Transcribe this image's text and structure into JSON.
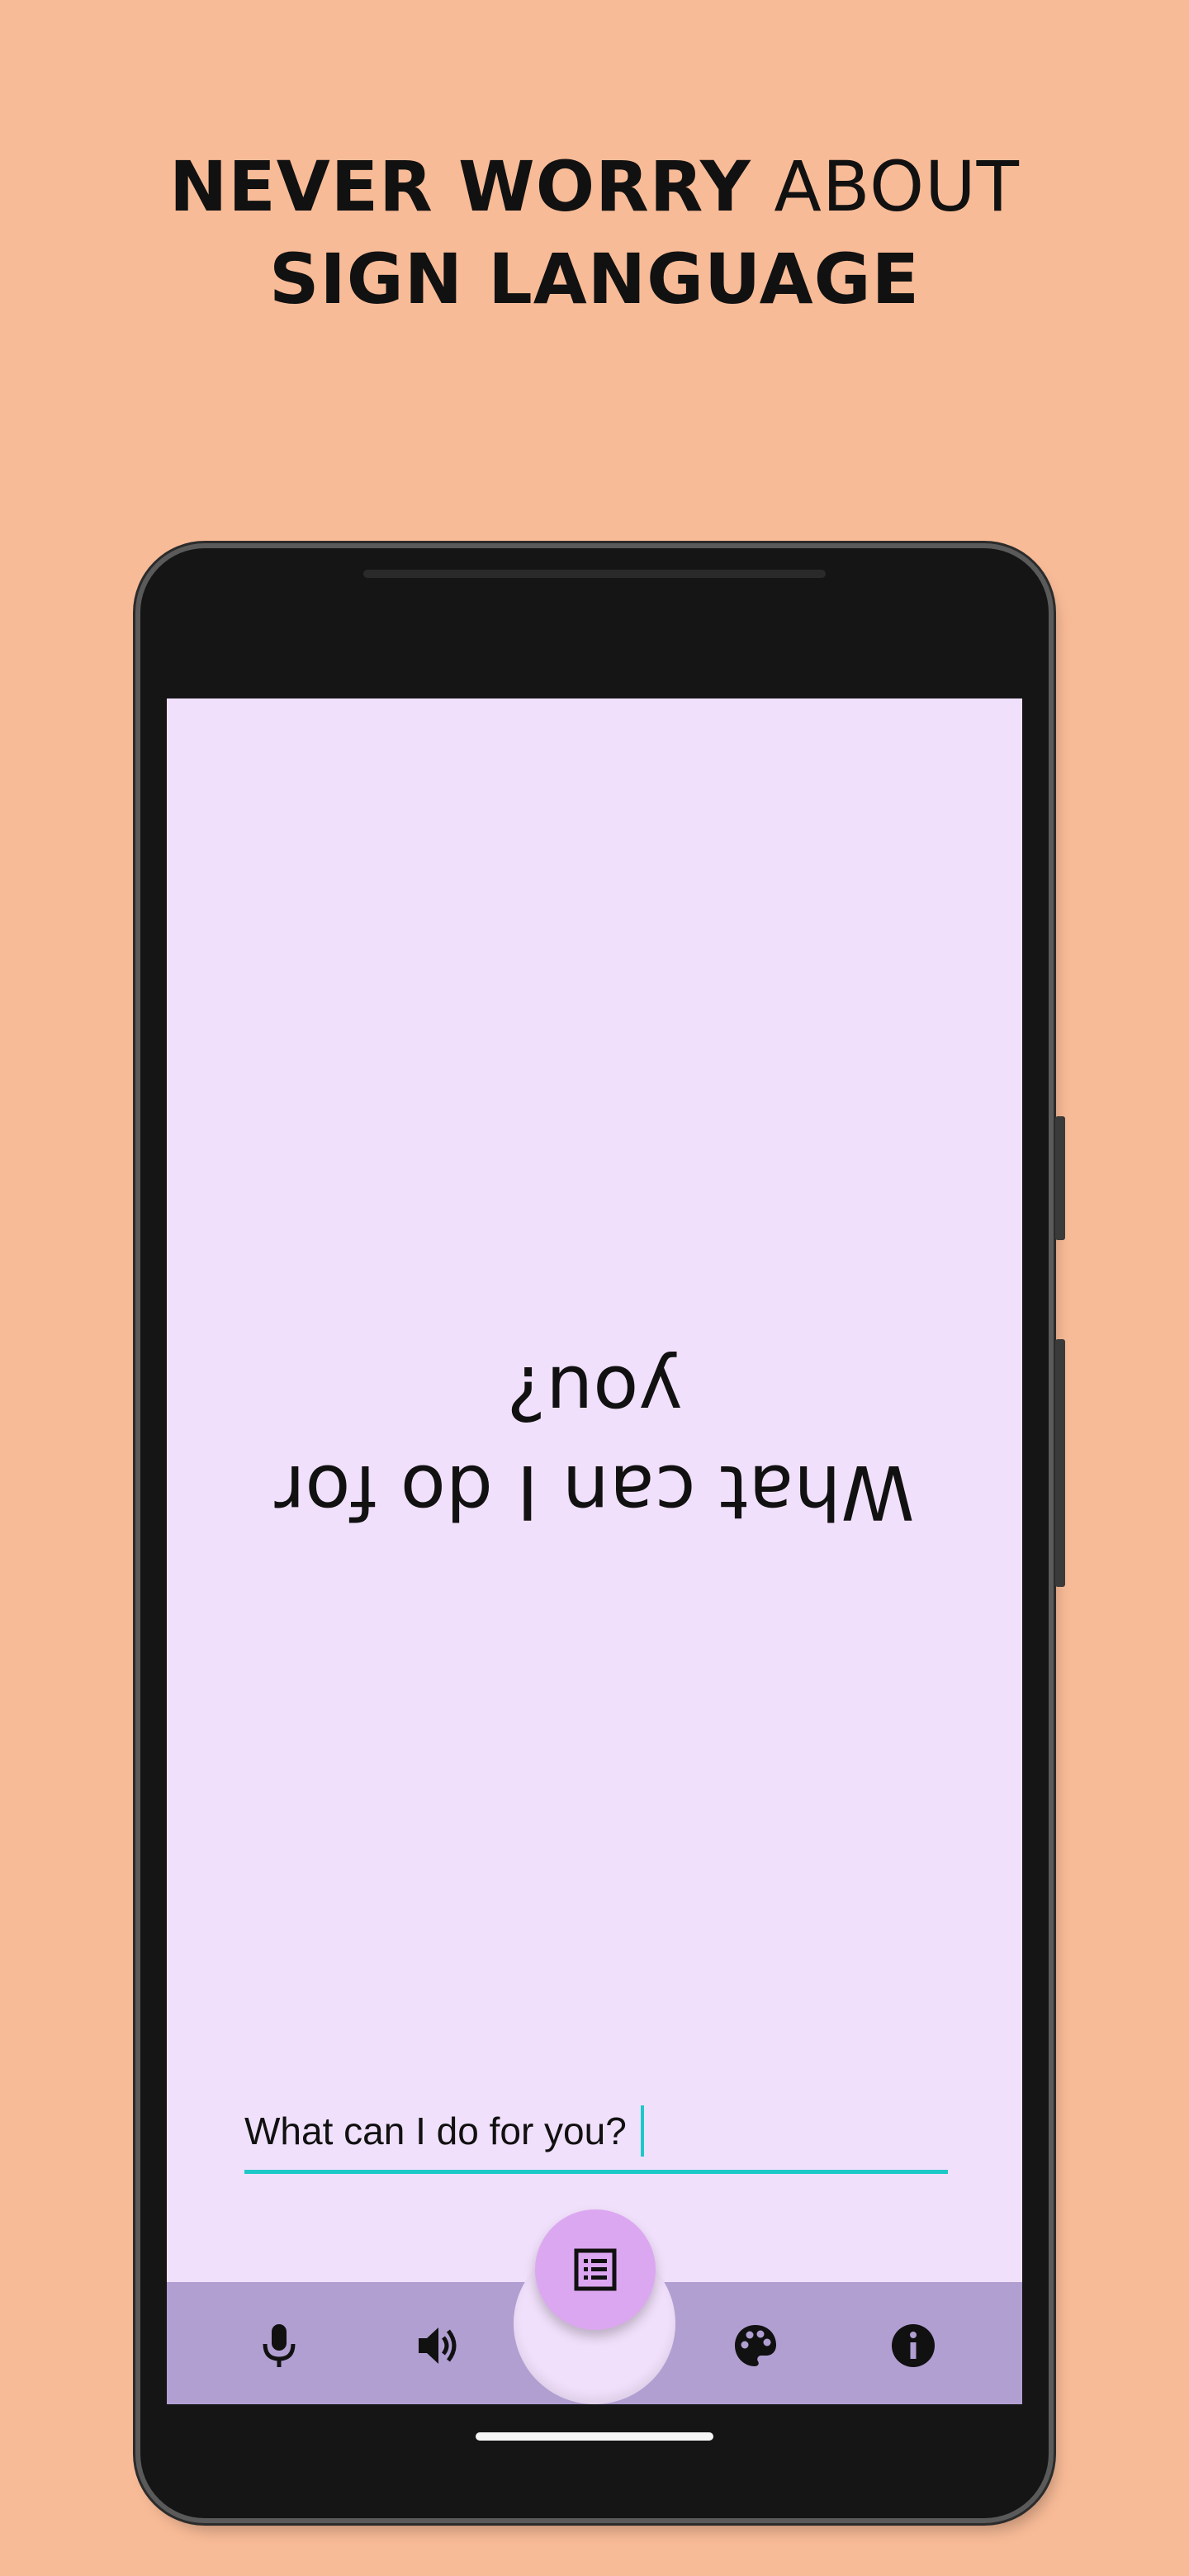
{
  "headline": {
    "line1_bold": "NEVER WORRY",
    "line1_light": " ABOUT",
    "line2": "SIGN LANGUAGE"
  },
  "display": {
    "flipped_text_line1": "What can I do for",
    "flipped_text_line2": "you?"
  },
  "input": {
    "value": "What can I do for you?"
  },
  "bottom_nav": {
    "left_icons": [
      "microphone-icon",
      "speaker-volume-icon"
    ],
    "right_icons": [
      "palette-icon",
      "info-icon"
    ],
    "fab_icon": "list-icon"
  },
  "colors": {
    "background": "#f8bb97",
    "screen": "#f1e0fb",
    "nav_bar": "#b19fd2",
    "fab": "#dca7f1",
    "input_underline": "#1ec8c8"
  }
}
